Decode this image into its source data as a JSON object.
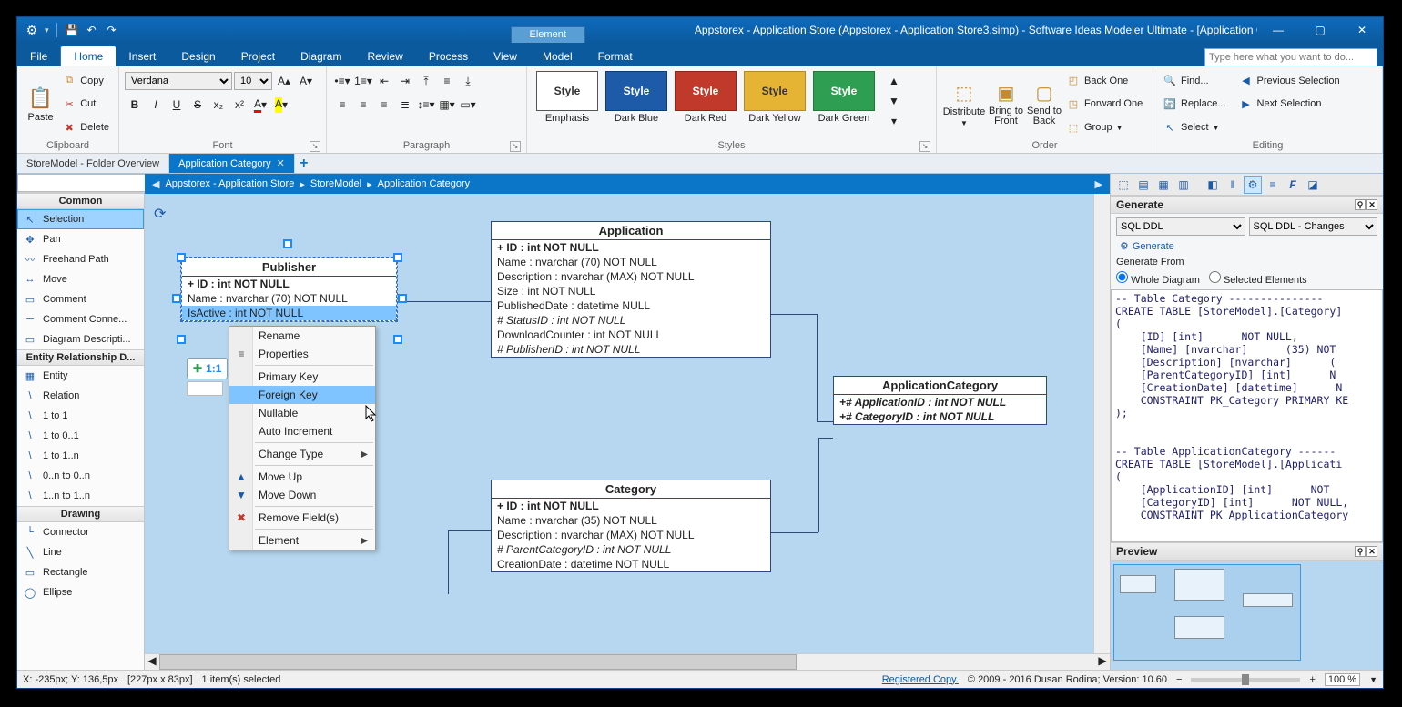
{
  "window": {
    "contextTab": "Element",
    "title": "Appstorex - Application Store (Appstorex - Application Store3.simp)  - Software Ideas Modeler Ultimate - [Application Category]"
  },
  "ribbonTabs": [
    "File",
    "Home",
    "Insert",
    "Design",
    "Project",
    "Diagram",
    "Review",
    "Process",
    "View",
    "Model",
    "Format"
  ],
  "activeRibbonTab": "Home",
  "helpPlaceholder": "Type here what you want to do...",
  "ribbon": {
    "clipboard": {
      "label": "Clipboard",
      "paste": "Paste",
      "copy": "Copy",
      "cut": "Cut",
      "delete": "Delete"
    },
    "font": {
      "label": "Font",
      "family": "Verdana",
      "size": "10"
    },
    "paragraph": {
      "label": "Paragraph"
    },
    "styles": {
      "label": "Styles",
      "list": [
        {
          "name": "Emphasis",
          "bg": "#ffffff",
          "fg": "#333",
          "border": "#555"
        },
        {
          "name": "Dark Blue",
          "bg": "#1d5aa8",
          "fg": "#fff",
          "border": "#0d3a78"
        },
        {
          "name": "Dark Red",
          "bg": "#c0392b",
          "fg": "#fff",
          "border": "#8a261c"
        },
        {
          "name": "Dark Yellow",
          "bg": "#e6b435",
          "fg": "#333",
          "border": "#b78a1f"
        },
        {
          "name": "Dark Green",
          "bg": "#2e9e53",
          "fg": "#fff",
          "border": "#1f7a3c"
        }
      ]
    },
    "order": {
      "label": "Order",
      "distribute": "Distribute",
      "bringFront": "Bring to Front",
      "sendBack": "Send to Back",
      "backOne": "Back One",
      "forwardOne": "Forward One",
      "group": "Group"
    },
    "editing": {
      "label": "Editing",
      "find": "Find...",
      "replace": "Replace...",
      "select": "Select",
      "prevSel": "Previous Selection",
      "nextSel": "Next Selection"
    }
  },
  "docTabs": {
    "inactive": "StoreModel - Folder Overview",
    "active": "Application Category"
  },
  "breadcrumb": [
    "Appstorex - Application Store",
    "StoreModel",
    "Application Category"
  ],
  "leftPanel": {
    "groups": [
      {
        "title": "Common",
        "items": [
          {
            "label": "Selection",
            "icon": "↖",
            "sel": true
          },
          {
            "label": "Pan",
            "icon": "✥"
          },
          {
            "label": "Freehand Path",
            "icon": "〰"
          },
          {
            "label": "Move",
            "icon": "↔"
          },
          {
            "label": "Comment",
            "icon": "▭"
          },
          {
            "label": "Comment Conne...",
            "icon": "─"
          },
          {
            "label": "Diagram Descripti...",
            "icon": "▭"
          }
        ]
      },
      {
        "title": "Entity Relationship D...",
        "items": [
          {
            "label": "Entity",
            "icon": "▦"
          },
          {
            "label": "Relation",
            "icon": "\\"
          },
          {
            "label": "1 to 1",
            "icon": "\\"
          },
          {
            "label": "1 to 0..1",
            "icon": "\\"
          },
          {
            "label": "1 to 1..n",
            "icon": "\\"
          },
          {
            "label": "0..n to 0..n",
            "icon": "\\"
          },
          {
            "label": "1..n to 1..n",
            "icon": "\\"
          }
        ]
      },
      {
        "title": "Drawing",
        "items": [
          {
            "label": "Connector",
            "icon": "└"
          },
          {
            "label": "Line",
            "icon": "╲"
          },
          {
            "label": "Rectangle",
            "icon": "▭"
          },
          {
            "label": "Ellipse",
            "icon": "◯"
          }
        ]
      }
    ]
  },
  "entities": {
    "publisher": {
      "title": "Publisher",
      "rows": [
        {
          "t": "+ ID : int NOT NULL",
          "pk": true
        },
        {
          "t": "Name : nvarchar (70)  NOT NULL"
        },
        {
          "t": "IsActive : int NOT NULL",
          "sel": true
        }
      ]
    },
    "application": {
      "title": "Application",
      "rows": [
        {
          "t": "+ ID : int NOT NULL",
          "pk": true
        },
        {
          "t": "Name : nvarchar (70)  NOT NULL"
        },
        {
          "t": "Description : nvarchar (MAX)  NOT NULL"
        },
        {
          "t": "Size : int NOT NULL"
        },
        {
          "t": "PublishedDate : datetime NULL"
        },
        {
          "t": "# StatusID : int NOT NULL",
          "fk": true
        },
        {
          "t": "DownloadCounter : int NOT NULL"
        },
        {
          "t": "# PublisherID : int NOT NULL",
          "fk": true
        }
      ]
    },
    "category": {
      "title": "Category",
      "rows": [
        {
          "t": "+ ID : int NOT NULL",
          "pk": true
        },
        {
          "t": "Name : nvarchar (35)  NOT NULL"
        },
        {
          "t": "Description : nvarchar (MAX)  NOT NULL"
        },
        {
          "t": "# ParentCategoryID : int NOT NULL",
          "fk": true
        },
        {
          "t": "CreationDate : datetime NOT NULL"
        }
      ]
    },
    "appcat": {
      "title": "ApplicationCategory",
      "rows": [
        {
          "t": "+# ApplicationID : int NOT NULL",
          "pk": true,
          "fk": true
        },
        {
          "t": "+# CategoryID : int NOT NULL",
          "pk": true,
          "fk": true
        }
      ]
    }
  },
  "relChip": "1:1",
  "contextMenu": {
    "items": [
      {
        "t": "Rename"
      },
      {
        "t": "Properties",
        "icon": "≡"
      },
      {
        "sep": true
      },
      {
        "t": "Primary Key"
      },
      {
        "t": "Foreign Key",
        "hov": true
      },
      {
        "t": "Nullable"
      },
      {
        "t": "Auto Increment"
      },
      {
        "sep": true
      },
      {
        "t": "Change Type",
        "sub": true
      },
      {
        "sep": true
      },
      {
        "t": "Move Up",
        "icon": "▲",
        "iconColor": "#1a5aa8"
      },
      {
        "t": "Move Down",
        "icon": "▼",
        "iconColor": "#1a5aa8"
      },
      {
        "sep": true
      },
      {
        "t": "Remove Field(s)",
        "icon": "✖",
        "iconColor": "#c0392b"
      },
      {
        "sep": true
      },
      {
        "t": "Element",
        "sub": true
      }
    ]
  },
  "rightPanel": {
    "generateTitle": "Generate",
    "ddl1": "SQL DDL",
    "ddl2": "SQL DDL - Changes",
    "generateBtn": "Generate",
    "generateFrom": "Generate From",
    "radioWhole": "Whole Diagram",
    "radioSel": "Selected Elements",
    "sql": "-- Table Category ---------------\nCREATE TABLE [StoreModel].[Category]\n(\n    [ID] [int]      NOT NULL,\n    [Name] [nvarchar]      (35) NOT\n    [Description] [nvarchar]      (\n    [ParentCategoryID] [int]      N\n    [CreationDate] [datetime]      N\n    CONSTRAINT PK_Category PRIMARY KE\n);\n\n\n-- Table ApplicationCategory ------\nCREATE TABLE [StoreModel].[Applicati\n(\n    [ApplicationID] [int]      NOT \n    [CategoryID] [int]      NOT NULL,\n    CONSTRAINT PK ApplicationCategory",
    "previewTitle": "Preview"
  },
  "status": {
    "coords": "X: -235px; Y: 136,5px",
    "size": "[227px x 83px]",
    "sel": "1 item(s) selected",
    "reg": "Registered Copy.",
    "copyright": "© 2009 - 2016 Dusan Rodina; Version: 10.60",
    "zoom": "100 %"
  }
}
